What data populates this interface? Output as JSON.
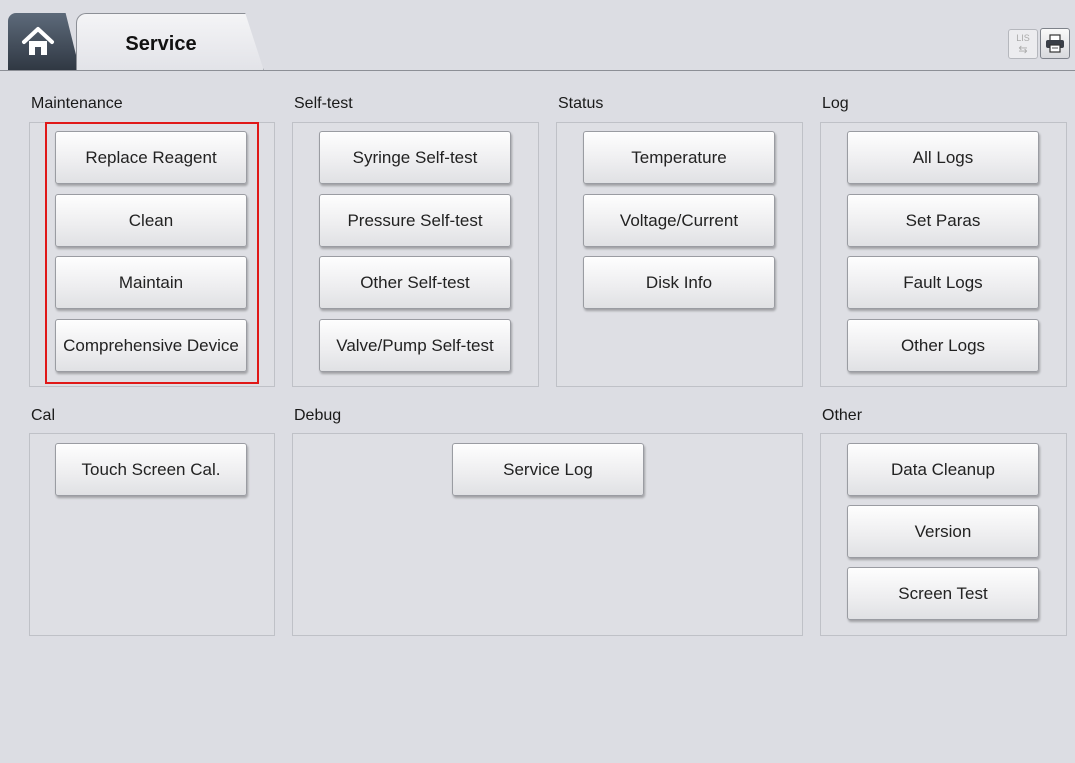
{
  "header": {
    "active_tab": "Service",
    "lis_label": "LIS",
    "lis_icon": "lis-arrows-icon",
    "printer_icon": "printer-icon",
    "home_icon": "home-icon"
  },
  "sections": {
    "maintenance": {
      "title": "Maintenance",
      "buttons": [
        "Replace Reagent",
        "Clean",
        "Maintain",
        "Comprehensive Device"
      ]
    },
    "selftest": {
      "title": "Self-test",
      "buttons": [
        "Syringe Self-test",
        "Pressure Self-test",
        "Other Self-test",
        "Valve/Pump Self-test"
      ]
    },
    "status": {
      "title": "Status",
      "buttons": [
        "Temperature",
        "Voltage/Current",
        "Disk Info"
      ]
    },
    "log": {
      "title": "Log",
      "buttons": [
        "All Logs",
        "Set Paras",
        "Fault Logs",
        "Other Logs"
      ]
    },
    "cal": {
      "title": "Cal",
      "buttons": [
        "Touch Screen Cal."
      ]
    },
    "debug": {
      "title": "Debug",
      "buttons": [
        "Service Log"
      ]
    },
    "other": {
      "title": "Other",
      "buttons": [
        "Data Cleanup",
        "Version",
        "Screen Test"
      ]
    }
  },
  "colors": {
    "highlight": "#e01818",
    "background": "#dcdde3"
  }
}
